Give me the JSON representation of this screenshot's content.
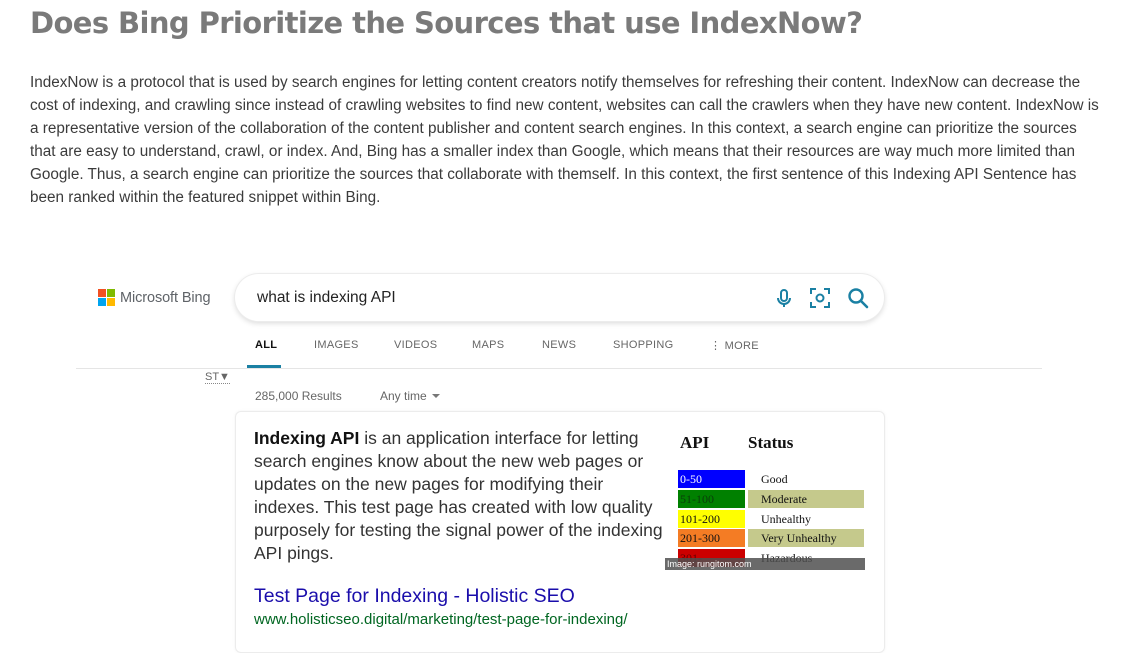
{
  "article": {
    "title": "Does Bing Prioritize the Sources that use IndexNow?",
    "body": "IndexNow is a protocol that is used by search engines for letting content creators notify themselves for refreshing their content. IndexNow can decrease the cost of indexing, and crawling since instead of crawling websites to find new content, websites can call the crawlers when they have new content. IndexNow is a representative version of the collaboration of the content publisher and content search engines. In this context, a search engine can prioritize the sources that are easy to understand, crawl, or index. And, Bing has a smaller index than Google, which means that their resources are way much more limited than Google. Thus, a search engine can prioritize the sources that collaborate with themself. In this context, the first sentence of this Indexing API Sentence has been ranked within the featured snippet within Bing."
  },
  "bing": {
    "logo_text": "Microsoft Bing",
    "logo_colors": [
      "#f25022",
      "#7fba00",
      "#00a4ef",
      "#ffb900"
    ],
    "search_query": "what is indexing API",
    "search_icons": [
      "microphone-icon",
      "visual-search-icon",
      "search-icon"
    ],
    "accent_color": "#1a80a3",
    "tabs": [
      {
        "label": "ALL",
        "active": true
      },
      {
        "label": "IMAGES",
        "active": false
      },
      {
        "label": "VIDEOS",
        "active": false
      },
      {
        "label": "MAPS",
        "active": false
      },
      {
        "label": "NEWS",
        "active": false
      },
      {
        "label": "SHOPPING",
        "active": false
      },
      {
        "label": "⋮ MORE",
        "active": false
      }
    ],
    "st_label": "ST▼",
    "results_count": "285,000 Results",
    "time_filter": "Any time",
    "snippet": {
      "bold": "Indexing API",
      "text": " is an application interface for letting search engines know about the new web pages or updates on the new pages for modifying their indexes. This test page has created with low quality purposely for testing the signal power of the indexing API pings."
    },
    "result": {
      "title": "Test Page for Indexing - Holistic SEO",
      "url": "www.holisticseo.digital/marketing/test-page-for-indexing/"
    },
    "image": {
      "header_api": "API",
      "header_status": "Status",
      "rows": [
        {
          "range": "0-50",
          "status": "Good",
          "color": "#0000ff",
          "text_color": "#ffffff"
        },
        {
          "range": "51-100",
          "status": "Moderate",
          "color": "#008000",
          "text_color": "#0a3d0a"
        },
        {
          "range": "101-200",
          "status": "Unhealthy",
          "color": "#ffff00",
          "text_color": "#111111"
        },
        {
          "range": "201-300",
          "status": "Very Unhealthy",
          "color": "#f47c24",
          "text_color": "#111111"
        },
        {
          "range": "301-",
          "status": "Hazardous",
          "color": "#cc0000",
          "text_color": "#660000"
        }
      ],
      "status_shade": "#c5c98c",
      "credit": "Image: rungitom.com"
    }
  }
}
